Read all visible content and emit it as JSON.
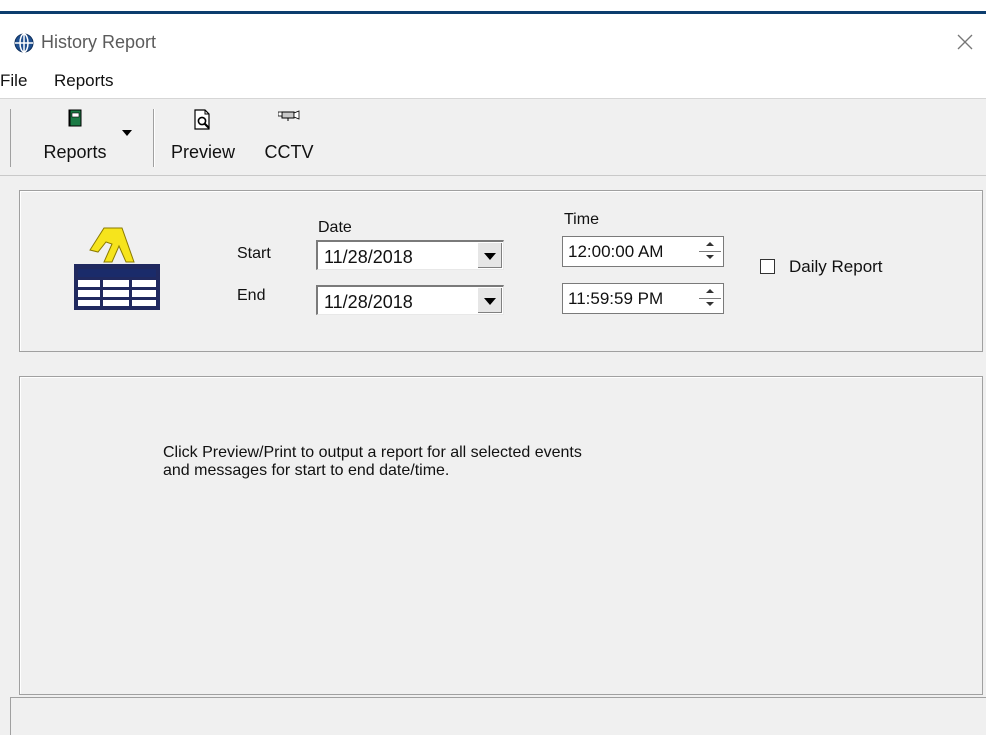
{
  "window": {
    "title": "History Report",
    "icon": "globe-icon",
    "close_icon": "close-icon"
  },
  "menu": {
    "items": [
      {
        "label": "File"
      },
      {
        "label": "Reports"
      }
    ]
  },
  "toolbar": {
    "buttons": [
      {
        "label": "Reports",
        "icon": "book-icon",
        "has_dropdown": true
      },
      {
        "label": "Preview",
        "icon": "print-preview-icon"
      },
      {
        "label": "CCTV",
        "icon": "camera-icon"
      }
    ]
  },
  "form": {
    "date_header": "Date",
    "time_header": "Time",
    "start_label": "Start",
    "end_label": "End",
    "start_date": "11/28/2018",
    "end_date": "11/28/2018",
    "start_time": "12:00:00 AM",
    "end_time": "11:59:59 PM",
    "daily_report_label": "Daily Report",
    "daily_report_checked": false
  },
  "message": {
    "line1": "Click Preview/Print to output a report for all selected events",
    "line2": "and messages for start to end date/time."
  },
  "colors": {
    "background": "#f0f0f0",
    "title_accent": "#0c3d6e",
    "figure_yellow": "#f6e41c"
  }
}
